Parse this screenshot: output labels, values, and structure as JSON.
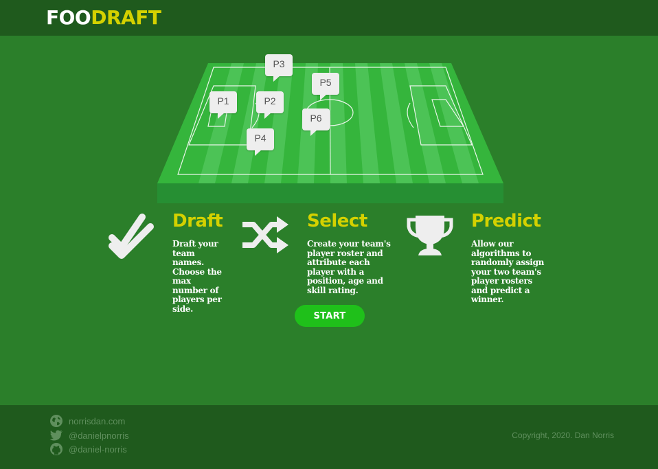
{
  "header": {
    "logo_part1": "FOO",
    "logo_part2": "DRAFT"
  },
  "pitch": {
    "players": [
      "P1",
      "P2",
      "P3",
      "P4",
      "P5",
      "P6"
    ]
  },
  "features": [
    {
      "title": "Draft",
      "text": "Draft your team names. Choose the max number of players per side.",
      "icon": "double-check-icon"
    },
    {
      "title": "Select",
      "text": "Create your team's player roster and attribute each player with a position, age and skill rating.",
      "icon": "shuffle-icon"
    },
    {
      "title": "Predict",
      "text": "Allow our algorithms to randomly assign your two team's player rosters and predict a winner.",
      "icon": "trophy-icon"
    }
  ],
  "start_button": {
    "label": "START"
  },
  "footer": {
    "links": [
      {
        "label": "norrisdan.com",
        "icon": "globe-icon"
      },
      {
        "label": "@danielpnorris",
        "icon": "twitter-icon"
      },
      {
        "label": "@daniel-norris",
        "icon": "github-icon"
      }
    ],
    "copyright": "Copyright, 2020. Dan Norris"
  },
  "colors": {
    "background": "#2b7f2a",
    "header": "#1f5a1d",
    "accent": "#d4d100",
    "button": "#1fc01a"
  }
}
